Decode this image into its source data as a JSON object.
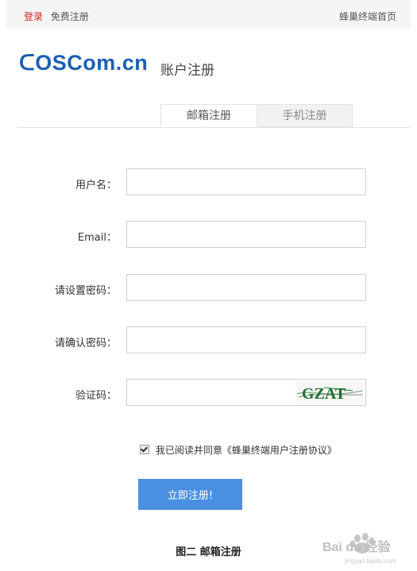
{
  "topbar": {
    "login": "登录",
    "register": "免费注册",
    "home": "蜂巢终端首页"
  },
  "brand": {
    "logo": "ᑕOSCom.cn",
    "subtitle": "账户注册"
  },
  "tabs": [
    {
      "label": "邮箱注册",
      "active": true
    },
    {
      "label": "手机注册",
      "active": false
    }
  ],
  "form": {
    "username": {
      "label": "用户名：",
      "value": ""
    },
    "email": {
      "label": "Email：",
      "value": ""
    },
    "password": {
      "label": "请设置密码：",
      "value": ""
    },
    "confirm": {
      "label": "请确认密码：",
      "value": ""
    },
    "captcha": {
      "label": "验证码：",
      "value": "",
      "image_text": "GZAT"
    }
  },
  "agreement": {
    "checked": true,
    "text": "我已阅读并同意《蜂巢终端用户注册协议》"
  },
  "submit_label": "立即注册!",
  "caption": "图二  邮箱注册",
  "watermark": {
    "text": "Bai du 经验",
    "sub": "jingyan.baidu.com"
  },
  "colors": {
    "accent": "#4a90e2",
    "brand": "#1a5fb4",
    "login": "#d0241b"
  }
}
